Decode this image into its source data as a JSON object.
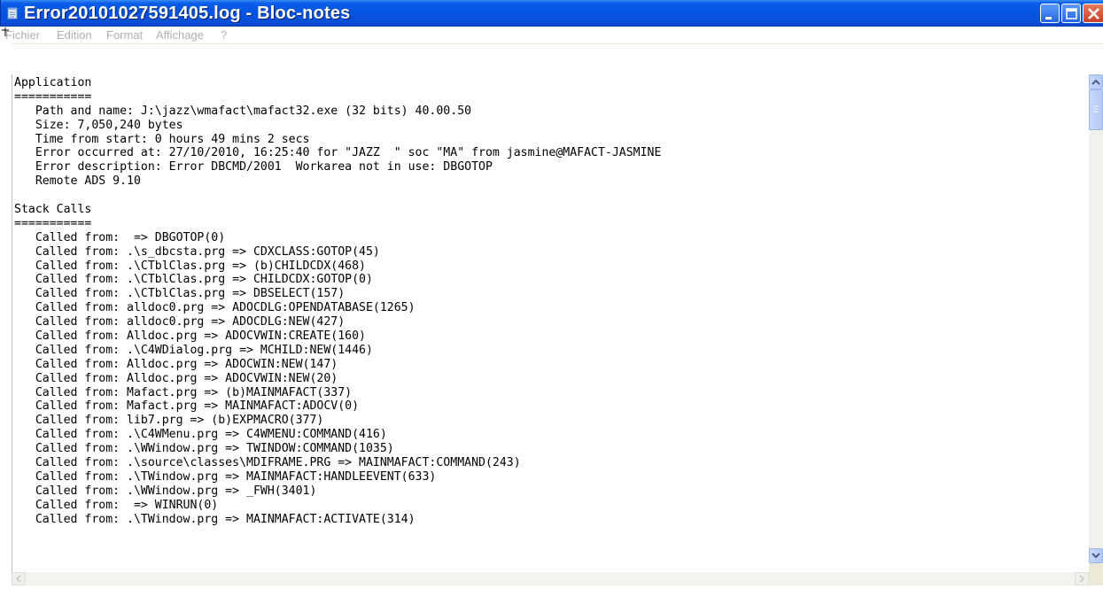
{
  "window": {
    "title": "Error20101027591405.log - Bloc-notes",
    "accent_color": "#0453e0"
  },
  "menu": {
    "items": [
      "Fichier",
      "Edition",
      "Format",
      "Affichage",
      "?"
    ]
  },
  "editor": {
    "lines": [
      "Application",
      "===========",
      "   Path and name: J:\\jazz\\wmafact\\mafact32.exe (32 bits) 40.00.50",
      "   Size: 7,050,240 bytes",
      "   Time from start: 0 hours 49 mins 2 secs",
      "   Error occurred at: 27/10/2010, 16:25:40 for \"JAZZ  \" soc \"MA\" from jasmine@MAFACT-JASMINE",
      "   Error description: Error DBCMD/2001  Workarea not in use: DBGOTOP",
      "   Remote ADS 9.10",
      "",
      "Stack Calls",
      "===========",
      "   Called from:  => DBGOTOP(0)",
      "   Called from: .\\s_dbcsta.prg => CDXCLASS:GOTOP(45)",
      "   Called from: .\\CTblClas.prg => (b)CHILDCDX(468)",
      "   Called from: .\\CTblClas.prg => CHILDCDX:GOTOP(0)",
      "   Called from: .\\CTblClas.prg => DBSELECT(157)",
      "   Called from: alldoc0.prg => ADOCDLG:OPENDATABASE(1265)",
      "   Called from: alldoc0.prg => ADOCDLG:NEW(427)",
      "   Called from: Alldoc.prg => ADOCVWIN:CREATE(160)",
      "   Called from: .\\C4WDialog.prg => MCHILD:NEW(1446)",
      "   Called from: Alldoc.prg => ADOCWIN:NEW(147)",
      "   Called from: Alldoc.prg => ADOCVWIN:NEW(20)",
      "   Called from: Mafact.prg => (b)MAINMAFACT(337)",
      "   Called from: Mafact.prg => MAINMAFACT:ADOCV(0)",
      "   Called from: lib7.prg => (b)EXPMACRO(377)",
      "   Called from: .\\C4WMenu.prg => C4WMENU:COMMAND(416)",
      "   Called from: .\\WWindow.prg => TWINDOW:COMMAND(1035)",
      "   Called from: .\\source\\classes\\MDIFRAME.PRG => MAINMAFACT:COMMAND(243)",
      "   Called from: .\\TWindow.prg => MAINMAFACT:HANDLEEVENT(633)",
      "   Called from: .\\WWindow.prg => _FWH(3401)",
      "   Called from:  => WINRUN(0)",
      "   Called from: .\\TWindow.prg => MAINMAFACT:ACTIVATE(314)"
    ]
  },
  "icons": {
    "app": "notepad-icon",
    "minimize": "minimize-icon",
    "maximize": "maximize-icon",
    "close": "close-icon",
    "scroll_up": "chevron-up-icon",
    "scroll_down": "chevron-down-icon",
    "scroll_left": "chevron-left-icon",
    "scroll_right": "chevron-right-icon"
  }
}
